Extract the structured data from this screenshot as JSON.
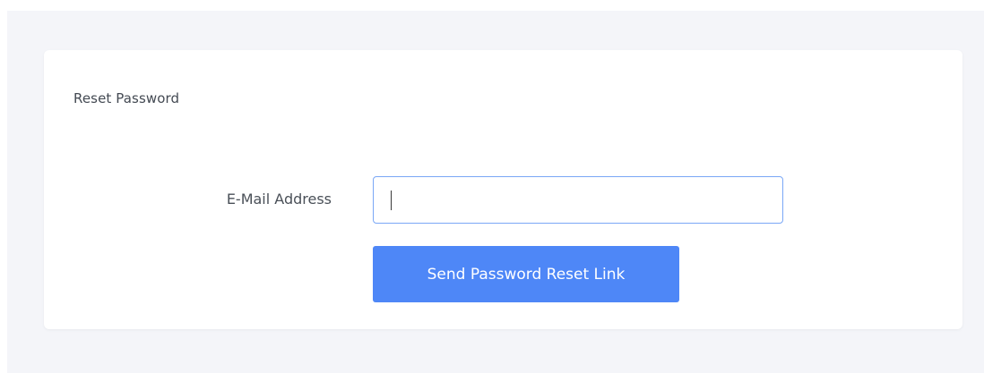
{
  "card": {
    "title": "Reset Password"
  },
  "form": {
    "email_label": "E-Mail Address",
    "email_value": "",
    "email_placeholder": "",
    "submit_label": "Send Password Reset Link"
  },
  "colors": {
    "page_background": "#f4f5f9",
    "card_background": "#ffffff",
    "input_border_focus": "#7aa7f6",
    "primary_button": "#4e87f7"
  }
}
